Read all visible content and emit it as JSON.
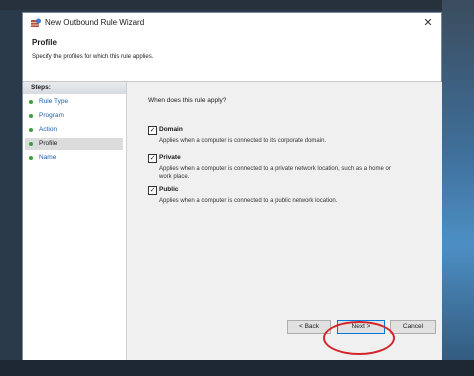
{
  "window": {
    "title": "New Outbound Rule Wizard",
    "close_glyph": "✕"
  },
  "header": {
    "page_title": "Profile",
    "description": "Specify the profiles for which this rule applies."
  },
  "steps": {
    "label": "Steps:",
    "items": [
      {
        "label": "Rule Type"
      },
      {
        "label": "Program"
      },
      {
        "label": "Action"
      },
      {
        "label": "Profile"
      },
      {
        "label": "Name"
      }
    ],
    "active": "Profile"
  },
  "main": {
    "question": "When does this rule apply?",
    "options": [
      {
        "title": "Domain",
        "desc": "Applies when a computer is connected to its corporate domain.",
        "checked": true
      },
      {
        "title": "Private",
        "desc": "Applies when a computer is connected to a private network location, such as a home or work place.",
        "checked": true
      },
      {
        "title": "Public",
        "desc": "Applies when a computer is connected to a public network location.",
        "checked": true
      }
    ],
    "check_glyph": "✓"
  },
  "buttons": {
    "back": "< Back",
    "next": "Next >",
    "cancel": "Cancel"
  },
  "colors": {
    "annotation_oval": "#d4242a",
    "step_dot": "#3aa23a",
    "step_link": "#1f5fa8"
  }
}
